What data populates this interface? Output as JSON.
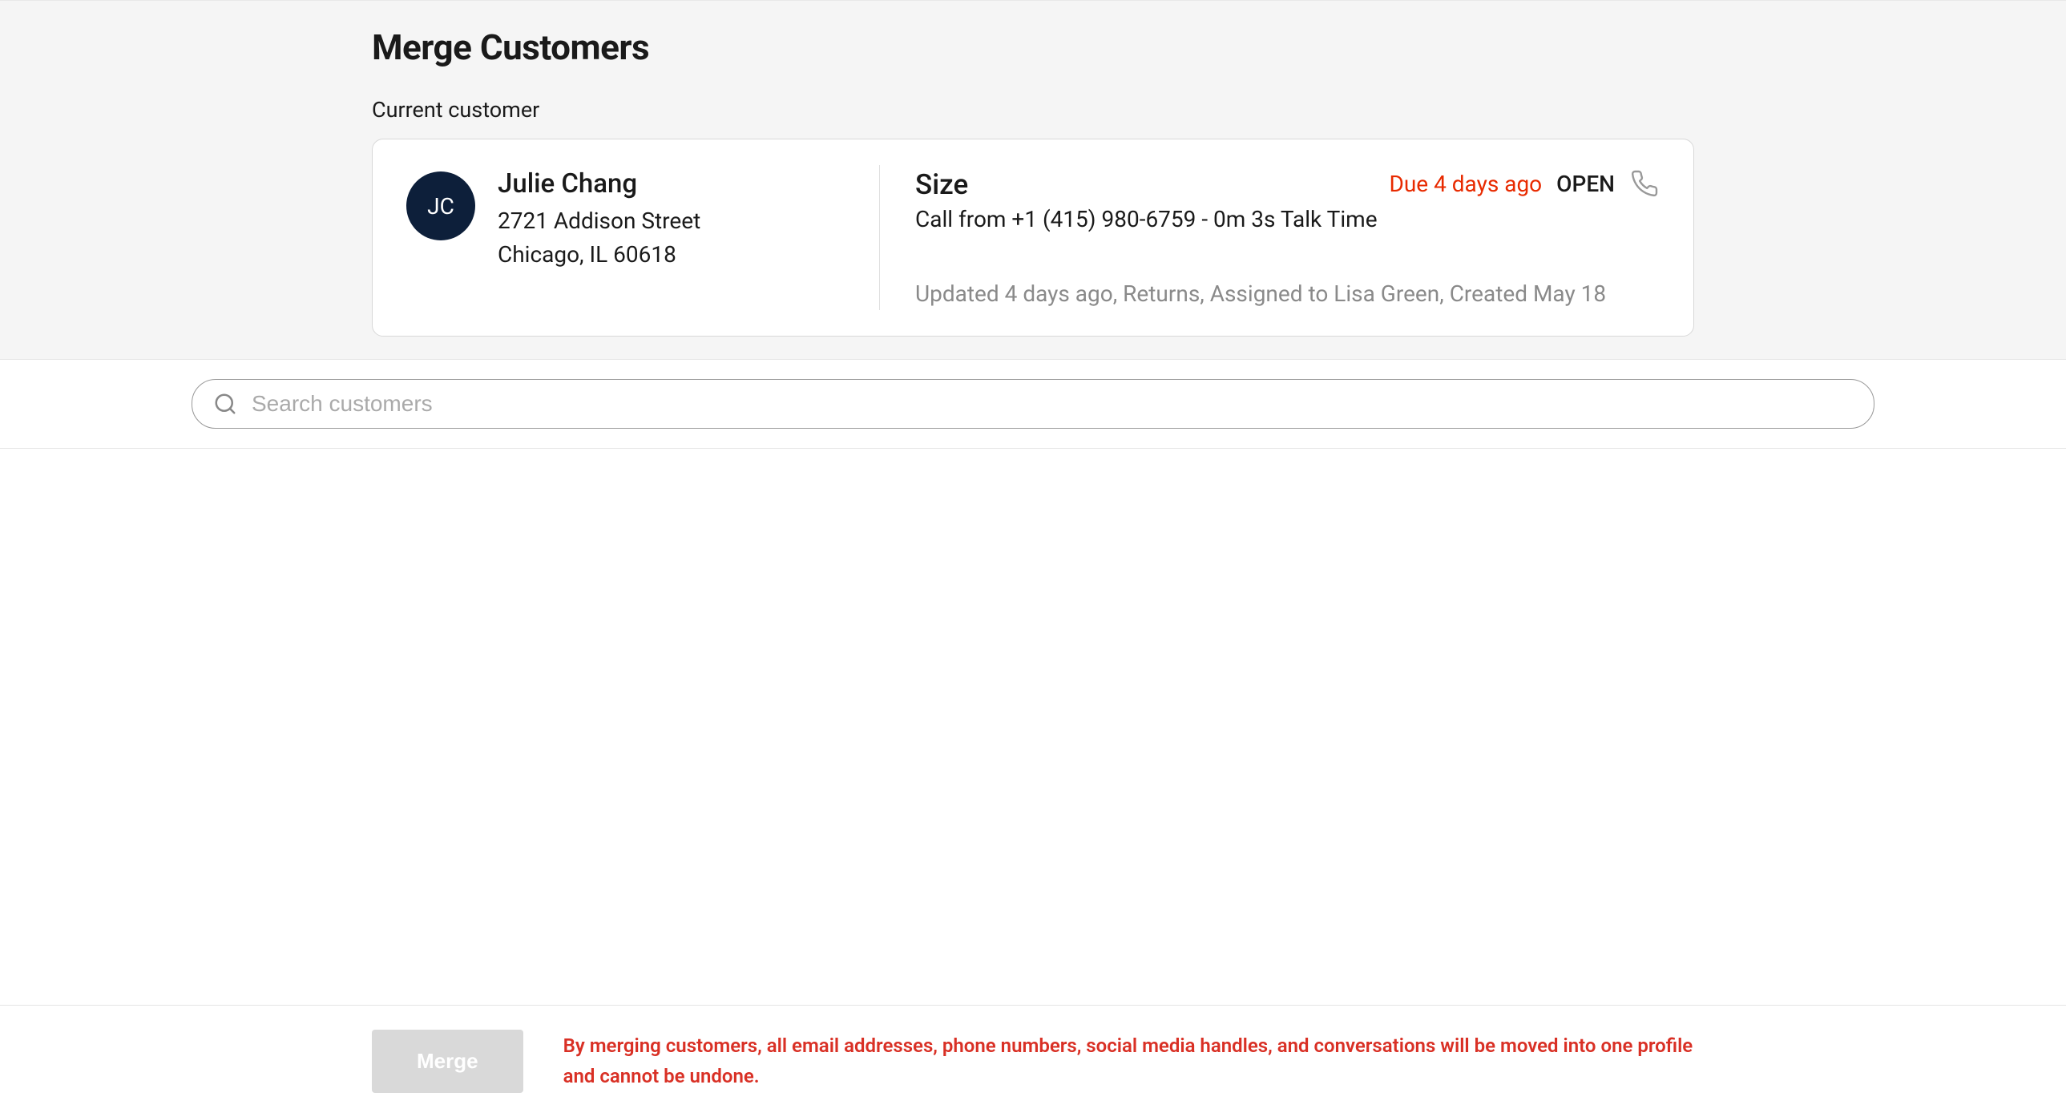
{
  "page": {
    "title": "Merge Customers",
    "current_label": "Current customer"
  },
  "customer": {
    "initials": "JC",
    "name": "Julie Chang",
    "address_line1": "2721 Addison Street",
    "address_line2": "Chicago, IL 60618"
  },
  "ticket": {
    "title": "Size",
    "subtitle": "Call from +1 (415) 980-6759 - 0m 3s Talk Time",
    "due": "Due 4 days ago",
    "status": "OPEN",
    "meta": "Updated 4 days ago, Returns, Assigned to Lisa Green, Created May 18"
  },
  "search": {
    "placeholder": "Search customers"
  },
  "footer": {
    "merge_label": "Merge",
    "warning": "By merging customers, all email addresses, phone numbers, social media handles, and conversations will be moved into one profile and cannot be undone."
  },
  "colors": {
    "danger": "#d93025",
    "due": "#e82a00",
    "avatar_bg": "#0d1f3a"
  }
}
